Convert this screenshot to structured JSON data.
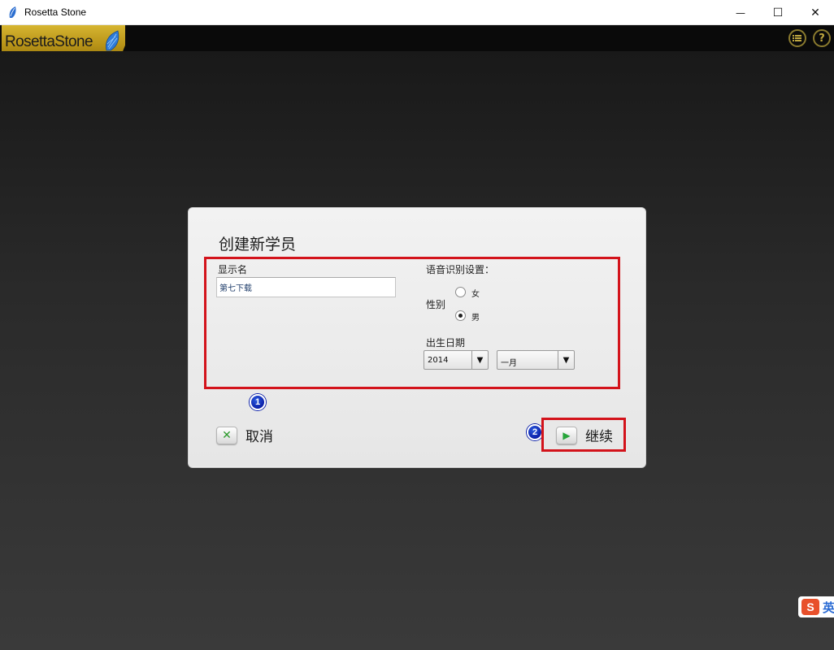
{
  "window": {
    "title": "Rosetta Stone",
    "minimize_glyph": "—",
    "maximize_glyph": "☐",
    "close_glyph": "✕"
  },
  "header": {
    "logo_text": "RosettaStone",
    "list_icon": "list-menu-icon",
    "help_icon": "help-icon",
    "help_glyph": "?"
  },
  "dialog": {
    "title": "创建新学员",
    "display_name_label": "显示名",
    "display_name_value": "第七下载",
    "speech_settings_label": "语音识别设置：",
    "gender_label": "性别",
    "gender_options": [
      "女",
      "男"
    ],
    "gender_selected": "男",
    "birth_date_label": "出生日期",
    "year_value": "2014",
    "month_value": "一月",
    "cancel_label": "取消",
    "continue_label": "继续"
  },
  "annotations": {
    "badge_1": "1",
    "badge_2": "2"
  },
  "ime": {
    "logo": "S",
    "mode": "英"
  },
  "colors": {
    "highlight_red": "#d3131b",
    "badge_blue": "#0b1fa8",
    "logo_gold": "#c9a623"
  }
}
